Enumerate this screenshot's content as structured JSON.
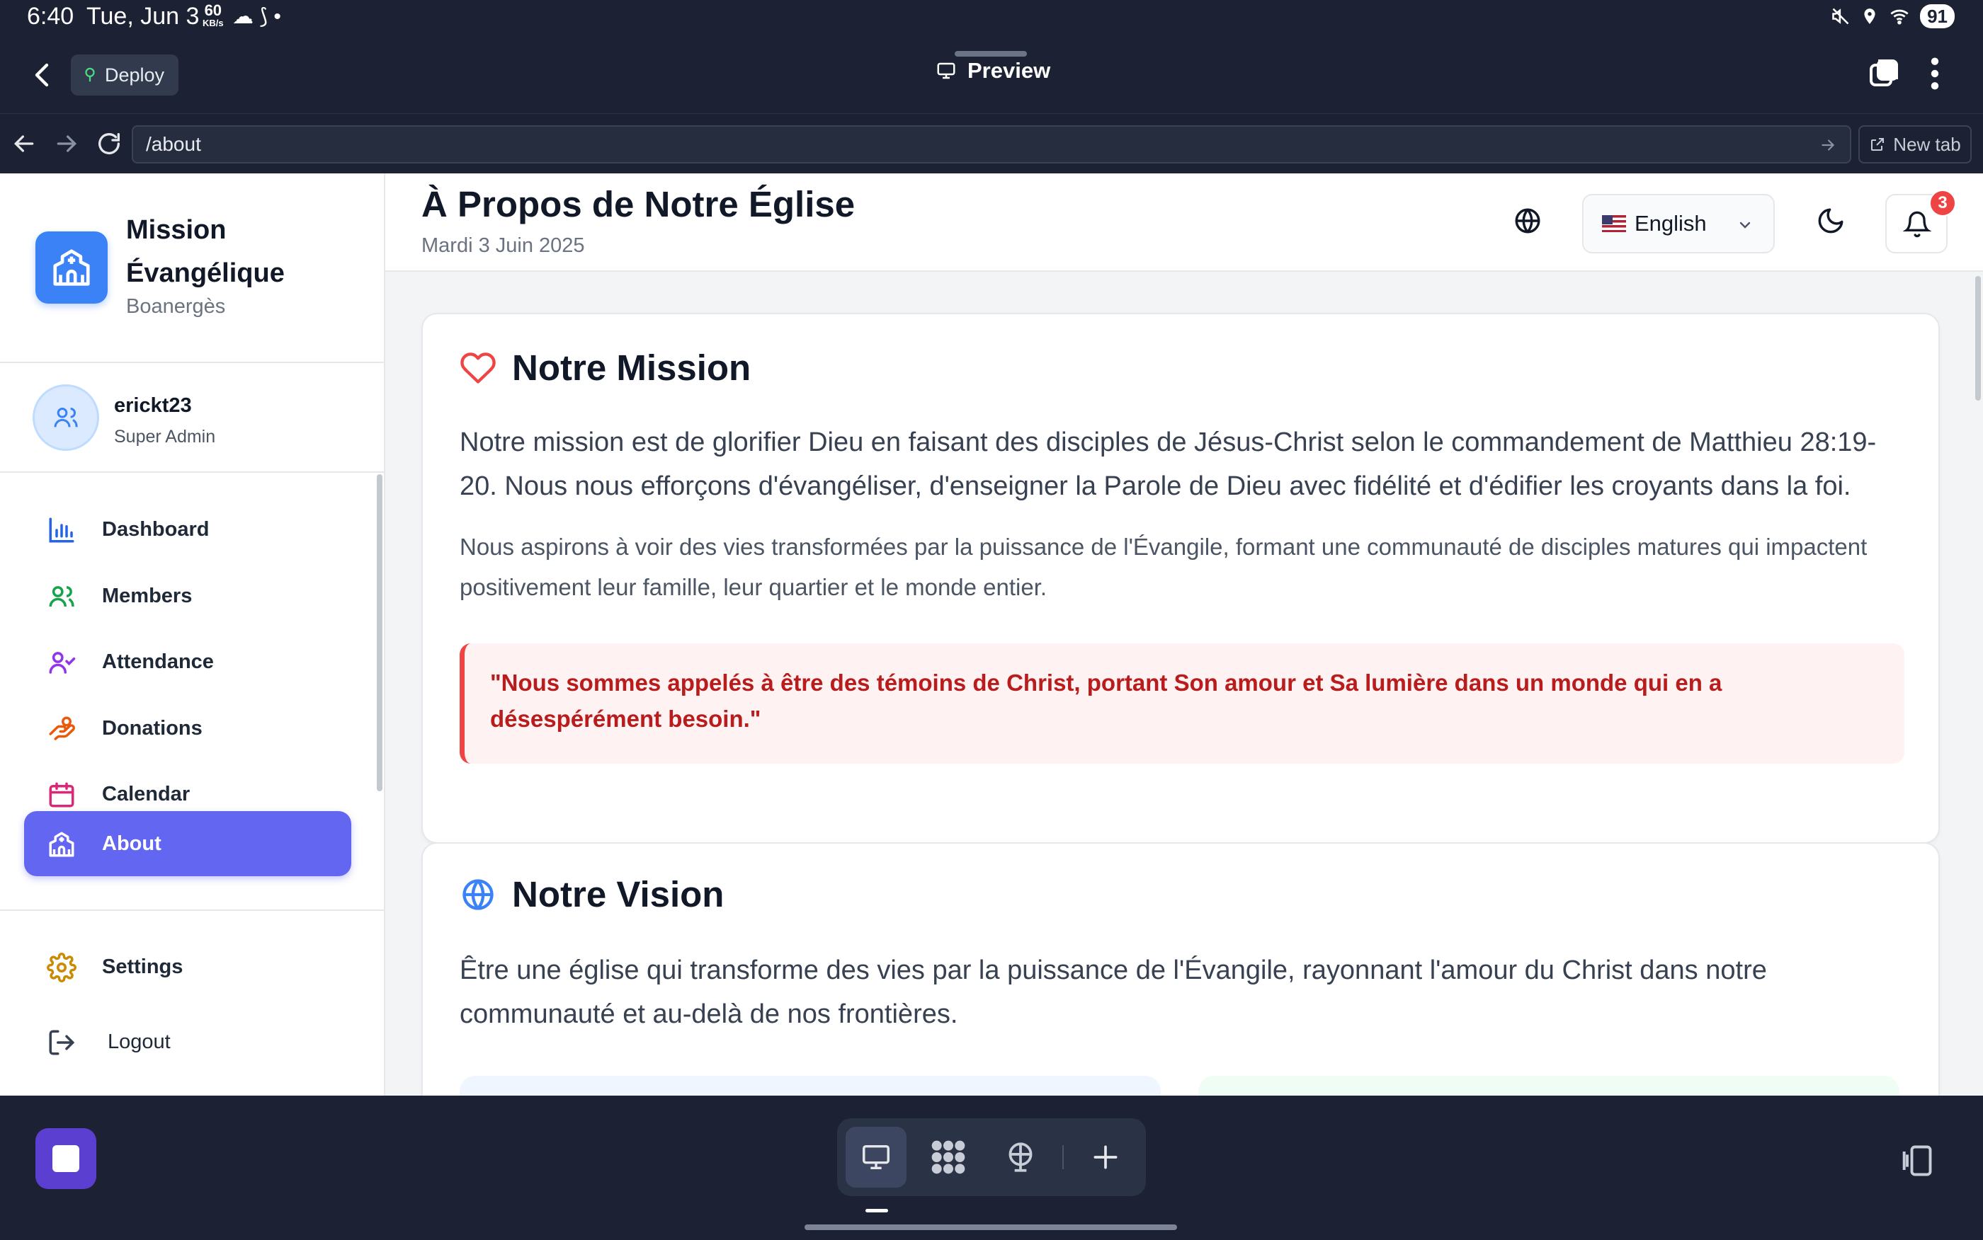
{
  "status_bar": {
    "time": "6:40",
    "date": "Tue, Jun 3",
    "net_speed": "60",
    "net_unit": "KB/s",
    "battery": "91"
  },
  "app_bar": {
    "deploy_label": "Deploy",
    "preview_label": "Preview"
  },
  "url_bar": {
    "url": "/about",
    "new_tab_label": "New tab"
  },
  "sidebar": {
    "brand_name": "Mission Évangélique",
    "brand_sub": "Boanergès",
    "user_name": "erickt23",
    "user_role": "Super Admin",
    "items": [
      {
        "label": "Dashboard",
        "icon": "bar-chart-icon",
        "color": "#2563eb"
      },
      {
        "label": "Members",
        "icon": "users-icon",
        "color": "#16a34a"
      },
      {
        "label": "Attendance",
        "icon": "user-check-icon",
        "color": "#9333ea"
      },
      {
        "label": "Donations",
        "icon": "hand-coins-icon",
        "color": "#ea580c"
      },
      {
        "label": "Calendar",
        "icon": "calendar-icon",
        "color": "#db2777"
      },
      {
        "label": "About",
        "icon": "church-icon",
        "color": "#ffffff"
      }
    ],
    "active_item": "About",
    "settings_label": "Settings",
    "logout_label": "Logout"
  },
  "header": {
    "title": "À Propos de Notre Église",
    "date": "Mardi 3 Juin 2025",
    "language": "English",
    "notification_count": "3"
  },
  "mission": {
    "title": "Notre Mission",
    "paragraph1": "Notre mission est de glorifier Dieu en faisant des disciples de Jésus-Christ selon le commandement de Matthieu 28:19-20. Nous nous efforçons d'évangéliser, d'enseigner la Parole de Dieu avec fidélité et d'édifier les croyants dans la foi.",
    "paragraph2": "Nous aspirons à voir des vies transformées par la puissance de l'Évangile, formant une communauté de disciples matures qui impactent positivement leur famille, leur quartier et le monde entier.",
    "quote": "\"Nous sommes appelés à être des témoins de Christ, portant Son amour et Sa lumière dans un monde qui en a désespérément besoin.\""
  },
  "vision": {
    "title": "Notre Vision",
    "paragraph": "Être une église qui transforme des vies par la puissance de l'Évangile, rayonnant l'amour du Christ dans notre communauté et au-delà de nos frontières."
  },
  "colors": {
    "accent": "#6366f1",
    "brand_blue": "#3b82f6",
    "quote_red": "#b91c1c",
    "chrome_dark": "#1c2233"
  }
}
